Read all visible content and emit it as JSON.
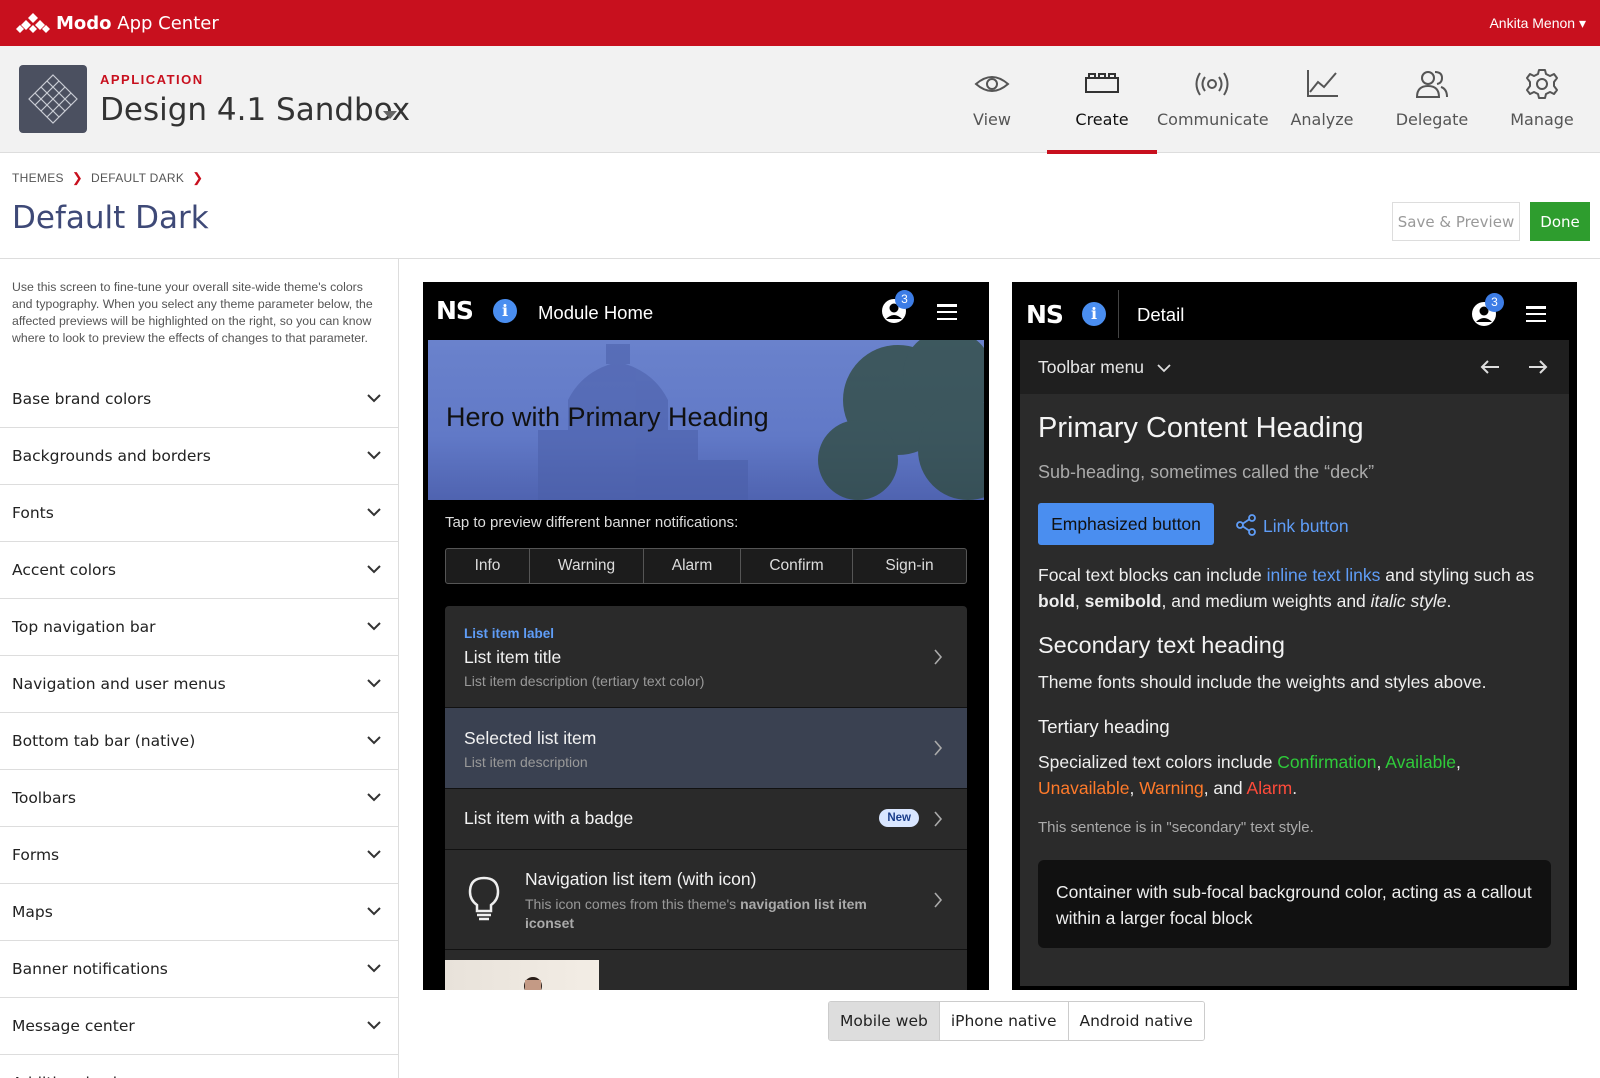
{
  "topbar": {
    "brand_bold": "Modo",
    "brand_rest": " App Center",
    "user": "Ankita Menon ▾"
  },
  "app": {
    "label": "APPLICATION",
    "name": "Design 4.1 Sandbox"
  },
  "nav_tabs": [
    {
      "label": "View",
      "icon": "eye-icon"
    },
    {
      "label": "Create",
      "icon": "bricks-icon",
      "active": true
    },
    {
      "label": "Communicate",
      "icon": "broadcast-icon"
    },
    {
      "label": "Analyze",
      "icon": "chart-icon"
    },
    {
      "label": "Delegate",
      "icon": "users-icon"
    },
    {
      "label": "Manage",
      "icon": "gear-icon"
    }
  ],
  "breadcrumb": [
    "THEMES",
    "DEFAULT DARK"
  ],
  "page_title": "Default Dark",
  "buttons": {
    "save": "Save & Preview",
    "done": "Done"
  },
  "sidebar": {
    "intro": "Use this screen to fine-tune your overall site-wide theme's colors and typography. When you select any theme parameter below, the affected previews will be highlighted on the right, so you can know where to look to preview the effects of changes to that parameter.",
    "sections": [
      "Base brand colors",
      "Backgrounds and borders",
      "Fonts",
      "Accent colors",
      "Top navigation bar",
      "Navigation and user menus",
      "Bottom tab bar (native)",
      "Toolbars",
      "Forms",
      "Maps",
      "Banner notifications",
      "Message center",
      "Additional colors"
    ]
  },
  "preview_left": {
    "logo": "NS",
    "title": "Module Home",
    "badge_count": "3",
    "hero": "Hero with Primary Heading",
    "tap_text": "Tap to preview different banner notifications:",
    "banner_tabs": [
      "Info",
      "Warning",
      "Alarm",
      "Confirm",
      "Sign-in"
    ],
    "list": {
      "item1_label": "List item label",
      "item1_title": "List item title",
      "item1_desc": "List item description (tertiary text color)",
      "item2_title": "Selected list item",
      "item2_desc": "List item description",
      "item3_title": "List item with a badge",
      "item3_badge": "New",
      "item4_title": "Navigation list item (with icon)",
      "item4_desc_a": "This icon comes from this theme's ",
      "item4_desc_b": "navigation list item iconset"
    }
  },
  "preview_right": {
    "logo": "NS",
    "title": "Detail",
    "badge_count": "3",
    "toolbar_menu": "Toolbar menu",
    "heading": "Primary Content Heading",
    "subheading": "Sub-heading, sometimes called the “deck”",
    "emphasized_button": "Emphasized button",
    "link_button": "Link button",
    "p1": {
      "a": "Focal text blocks can include ",
      "link": "inline text links",
      "b": " and styling such as ",
      "bold": "bold",
      "c": ", ",
      "semibold": "semibold",
      "d": ", and medium weights and ",
      "italic": "italic style",
      "e": "."
    },
    "secondary_heading": "Secondary text heading",
    "p2": "Theme fonts should include the weights and styles above.",
    "tertiary_heading": "Tertiary heading",
    "p3": {
      "a": "Specialized text colors include ",
      "confirmation": "Confirmation",
      "b": ", ",
      "available": "Available",
      "c": ",",
      "unavailable": "Unavailable",
      "d": ", ",
      "warning": "Warning",
      "e": ", and ",
      "alarm": "Alarm",
      "f": "."
    },
    "secondary_text": "This sentence is in \"secondary\" text style.",
    "callout": "Container with sub-focal background color, acting as a callout within a larger focal block"
  },
  "platforms": [
    {
      "label": "Mobile web",
      "selected": true
    },
    {
      "label": "iPhone native"
    },
    {
      "label": "Android native"
    }
  ],
  "colors": {
    "brand": "#c8101e",
    "accent_blue": "#4a8ef0",
    "done_green": "#2e9d2e",
    "title": "#3e4977"
  }
}
